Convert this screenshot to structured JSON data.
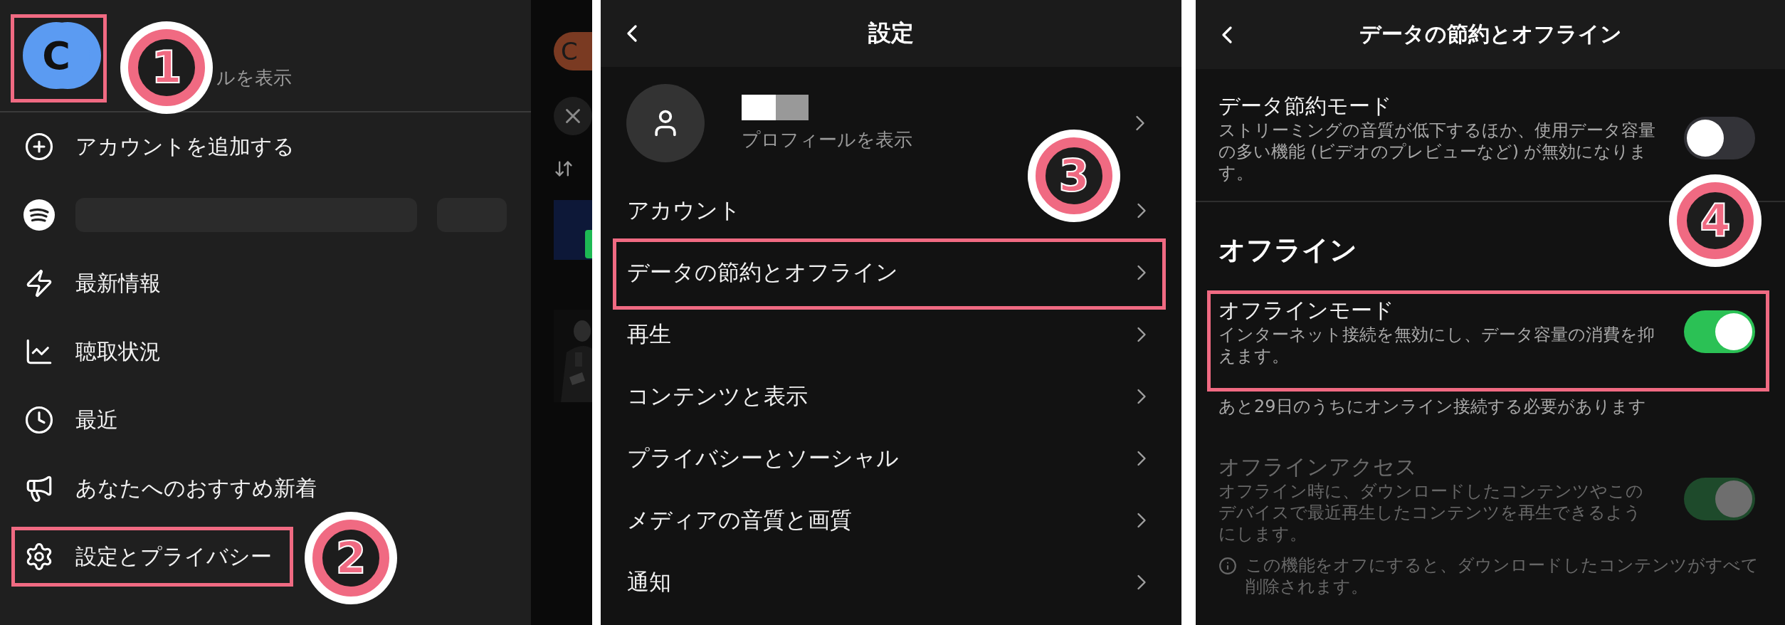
{
  "menu_panel": {
    "profile": {
      "avatar_initial": "C",
      "link": "ルを表示",
      "highlighted": true,
      "badge": "1"
    },
    "items": [
      {
        "kind": "link",
        "label": "アカウントを追加する",
        "highlighted": false
      },
      {
        "kind": "placeholder",
        "highlighted": false
      },
      {
        "kind": "link",
        "label": "最新情報",
        "highlighted": false
      },
      {
        "kind": "link",
        "label": "聴取状況",
        "highlighted": false
      },
      {
        "kind": "link",
        "label": "最近",
        "highlighted": false
      },
      {
        "kind": "link",
        "label": "あなたへのおすすめ新着",
        "highlighted": false
      },
      {
        "kind": "link",
        "label": "設定とプライバシー",
        "highlighted": true
      }
    ],
    "badge": "2"
  },
  "background_app": {
    "avatar_initial": "C"
  },
  "settings_panel": {
    "title": "設定",
    "profile": {
      "link": "プロフィールを表示"
    },
    "items": [
      {
        "label": "アカウント",
        "highlighted": false
      },
      {
        "label": "データの節約とオフライン",
        "highlighted": true
      },
      {
        "label": "再生",
        "highlighted": false
      },
      {
        "label": "コンテンツと表示",
        "highlighted": false
      },
      {
        "label": "プライバシーとソーシャル",
        "highlighted": false
      },
      {
        "label": "メディアの音質と画質",
        "highlighted": false
      },
      {
        "label": "通知",
        "highlighted": false
      }
    ],
    "badge": "3"
  },
  "offline_panel": {
    "title": "データの節約とオフライン",
    "data_saver": {
      "title": "データ節約モード",
      "description": "ストリーミングの音質が低下するほか、使用データ容量の多い機能 (ビデオのプレビューなど) が無効になります。",
      "on": false,
      "disabled": false,
      "highlighted": false
    },
    "section_title": "オフライン",
    "offline_mode": {
      "title": "オフラインモード",
      "description": "インターネット接続を無効にし、データ容量の消費を抑えます。",
      "on": true,
      "disabled": false,
      "highlighted": true
    },
    "notice": "あと29日のうちにオンライン接続する必要があります",
    "offline_access": {
      "title": "オフラインアクセス",
      "description": "オフライン時に、ダウンロードしたコンテンツやこのデバイスで最近再生したコンテンツを再生できるようにします。",
      "on": true,
      "disabled": true,
      "highlighted": false
    },
    "info_note": "この機能をオフにすると、ダウンロードしたコンテンツがすべて削除されます。",
    "badge": "4"
  }
}
